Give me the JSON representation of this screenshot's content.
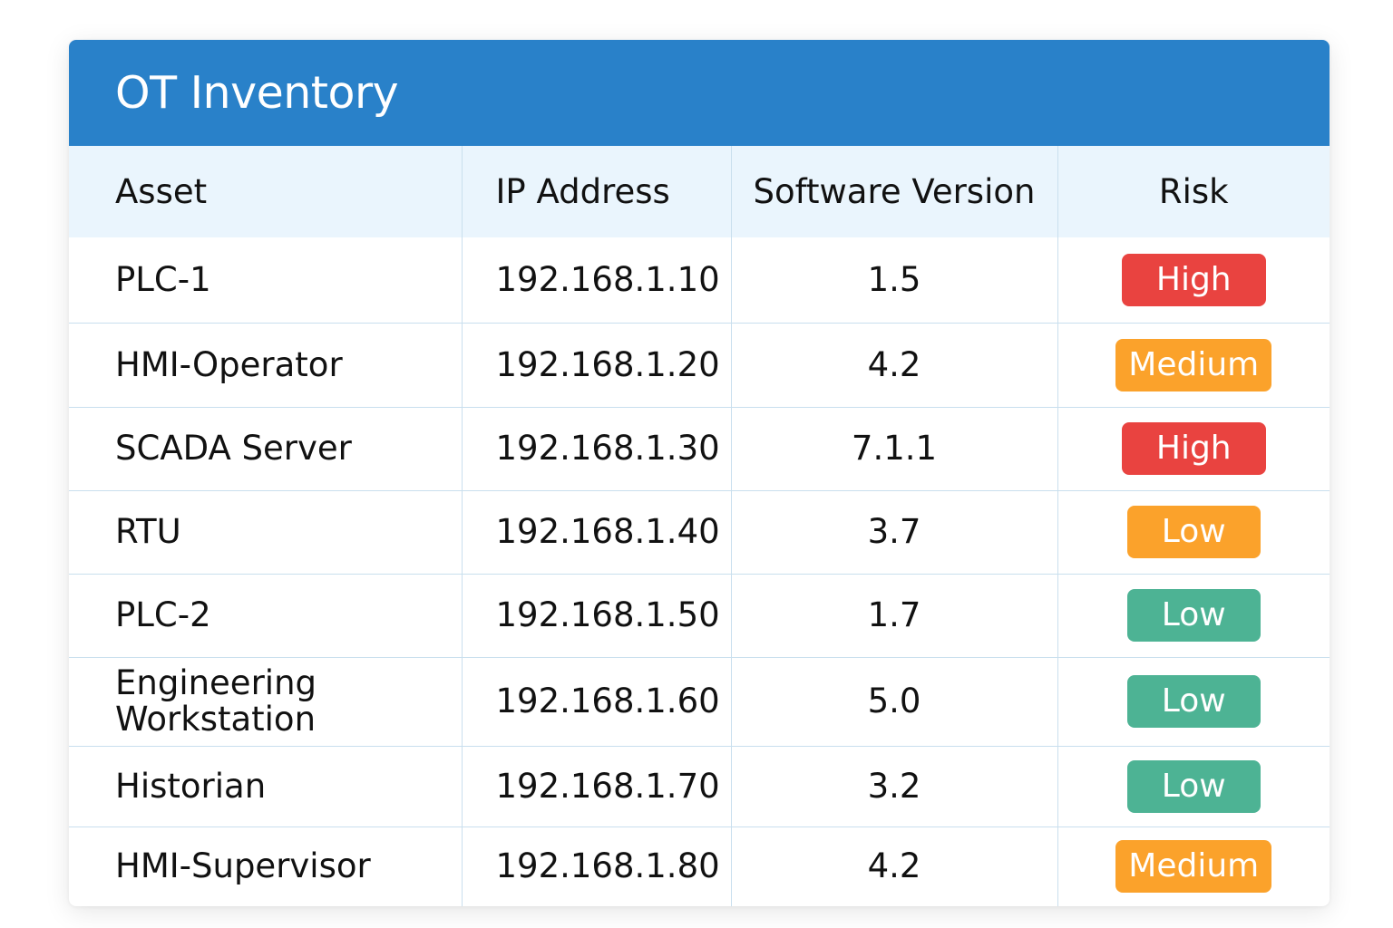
{
  "title": "OT Inventory",
  "columns": {
    "asset": "Asset",
    "ip": "IP Address",
    "version": "Software Version",
    "risk": "Risk"
  },
  "risk_colors": {
    "High": "#e94340",
    "Medium": "#fba22b",
    "Low_orange": "#fba22b",
    "Low_green": "#4db394",
    "header_bar": "#2981c9"
  },
  "rows": [
    {
      "asset": "PLC-1",
      "ip": "192.168.1.10",
      "version": "1.5",
      "risk": "High"
    },
    {
      "asset": "HMI-Operator",
      "ip": "192.168.1.20",
      "version": "4.2",
      "risk": "Medium"
    },
    {
      "asset": "SCADA Server",
      "ip": "192.168.1.30",
      "version": "7.1.1",
      "risk": "High"
    },
    {
      "asset": "RTU",
      "ip": "192.168.1.40",
      "version": "3.7",
      "risk": "Low"
    },
    {
      "asset": "PLC-2",
      "ip": "192.168.1.50",
      "version": "1.7",
      "risk": "Low"
    },
    {
      "asset": "Engineering Workstation",
      "ip": "192.168.1.60",
      "version": "5.0",
      "risk": "Low"
    },
    {
      "asset": "Historian",
      "ip": "192.168.1.70",
      "version": "3.2",
      "risk": "Low"
    },
    {
      "asset": "HMI-Supervisor",
      "ip": "192.168.1.80",
      "version": "4.2",
      "risk": "Medium"
    }
  ]
}
